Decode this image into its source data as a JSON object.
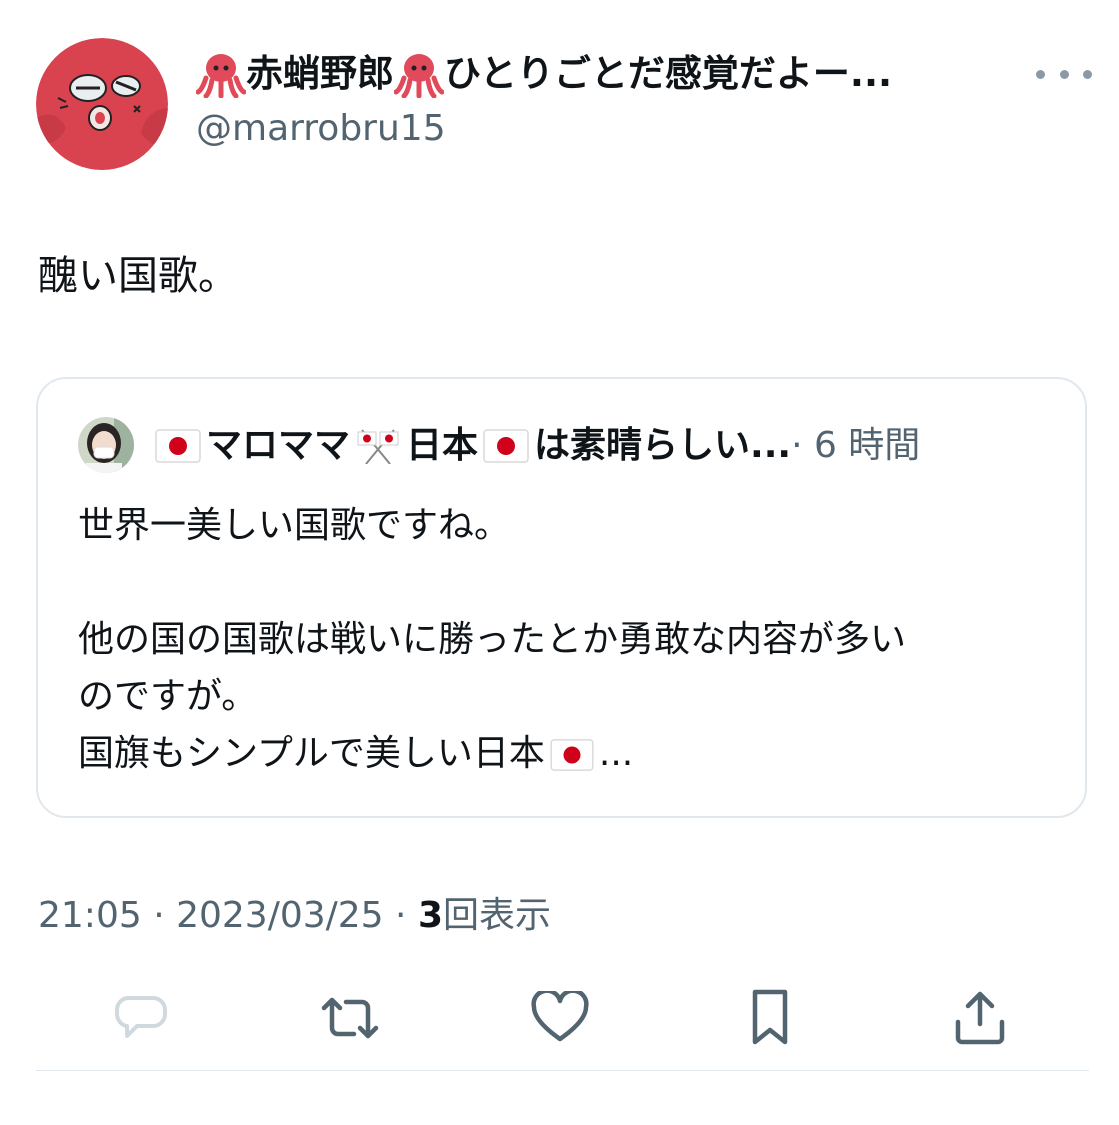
{
  "author": {
    "display_name_part1": "赤蛸野郎",
    "display_name_part2": "ひとりごとだ感覚だよー...",
    "handle": "@marrobru15",
    "avatar_icon": "octopus-avatar"
  },
  "tweet": {
    "text": "醜い国歌。"
  },
  "quoted_tweet": {
    "name_part1": "マロママ",
    "name_part2": "日本",
    "name_part3": "は素晴らしい...",
    "time": "· 6 時間",
    "lines": [
      "世界一美しい国歌ですね。",
      "",
      "他の国の国歌は戦いに勝ったとか勇敢な内容が多い",
      "のですが。",
      "国旗もシンプルで美しい日本"
    ],
    "ellipsis": "..."
  },
  "meta": {
    "time": "21:05",
    "separator1": " · ",
    "date": "2023/03/25",
    "separator2": " · ",
    "views_count": "3",
    "views_label": "回表示"
  },
  "actions": {
    "reply_icon": "reply-icon",
    "retweet_icon": "retweet-icon",
    "like_icon": "heart-icon",
    "bookmark_icon": "bookmark-icon",
    "share_icon": "share-icon"
  },
  "colors": {
    "text": "#0f1419",
    "secondary": "#536471",
    "border": "#e1e8ed",
    "octopus": "#e04a5a",
    "flag_red": "#d0021b"
  }
}
